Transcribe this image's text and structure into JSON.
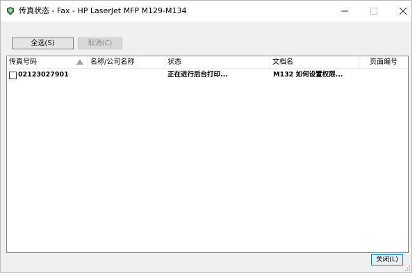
{
  "window": {
    "title": "传真状态 - Fax - HP LaserJet MFP M129-M134"
  },
  "toolbar": {
    "select_all_label": "全选(S)",
    "cancel_label": "取消(C)"
  },
  "list": {
    "columns": [
      "传真号码",
      "名称/公司名称",
      "状态",
      "文档名",
      "页面编号"
    ],
    "rows": [
      {
        "checked": false,
        "fax_number": "02123027901",
        "name": "",
        "status": "正在进行后台打印...",
        "document": "M132 如何设置权限...",
        "page": ""
      }
    ]
  },
  "footer": {
    "close_label": "关闭(L)"
  }
}
